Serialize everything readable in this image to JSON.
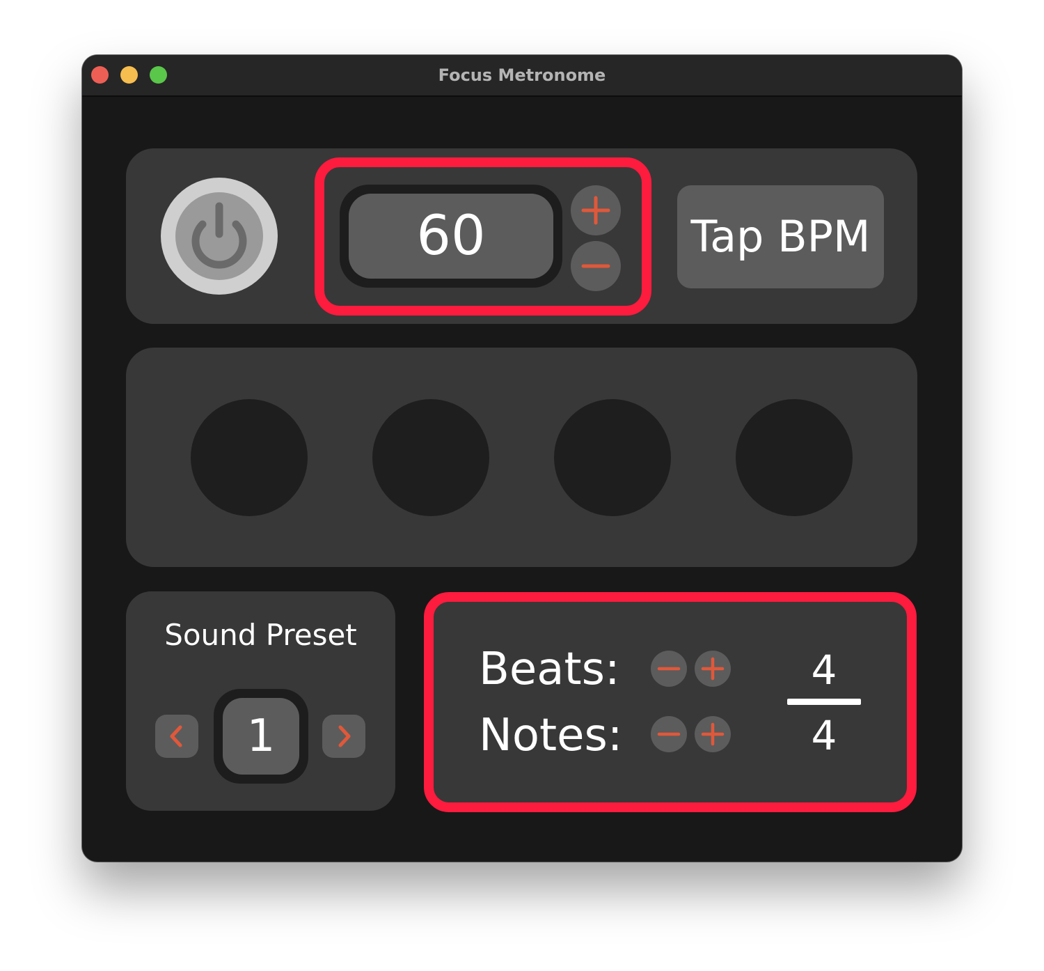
{
  "window": {
    "title": "Focus Metronome",
    "traffic_lights": {
      "close_color": "#ed5f55",
      "minimize_color": "#f6bd4f",
      "zoom_color": "#5ac64a"
    }
  },
  "controls": {
    "power_icon": "power-icon",
    "bpm": {
      "value": "60",
      "increment_icon": "plus-icon",
      "decrement_icon": "minus-icon"
    },
    "tap_label": "Tap BPM"
  },
  "beats_panel": {
    "beat_count": 4
  },
  "sound_preset": {
    "title": "Sound Preset",
    "value": "1",
    "prev_icon": "chevron-left-icon",
    "next_icon": "chevron-right-icon"
  },
  "time_signature": {
    "beats_label": "Beats:",
    "notes_label": "Notes:",
    "beats_value": "4",
    "notes_value": "4"
  },
  "colors": {
    "accent": "#e0583a",
    "highlight": "#fd1b3e"
  }
}
